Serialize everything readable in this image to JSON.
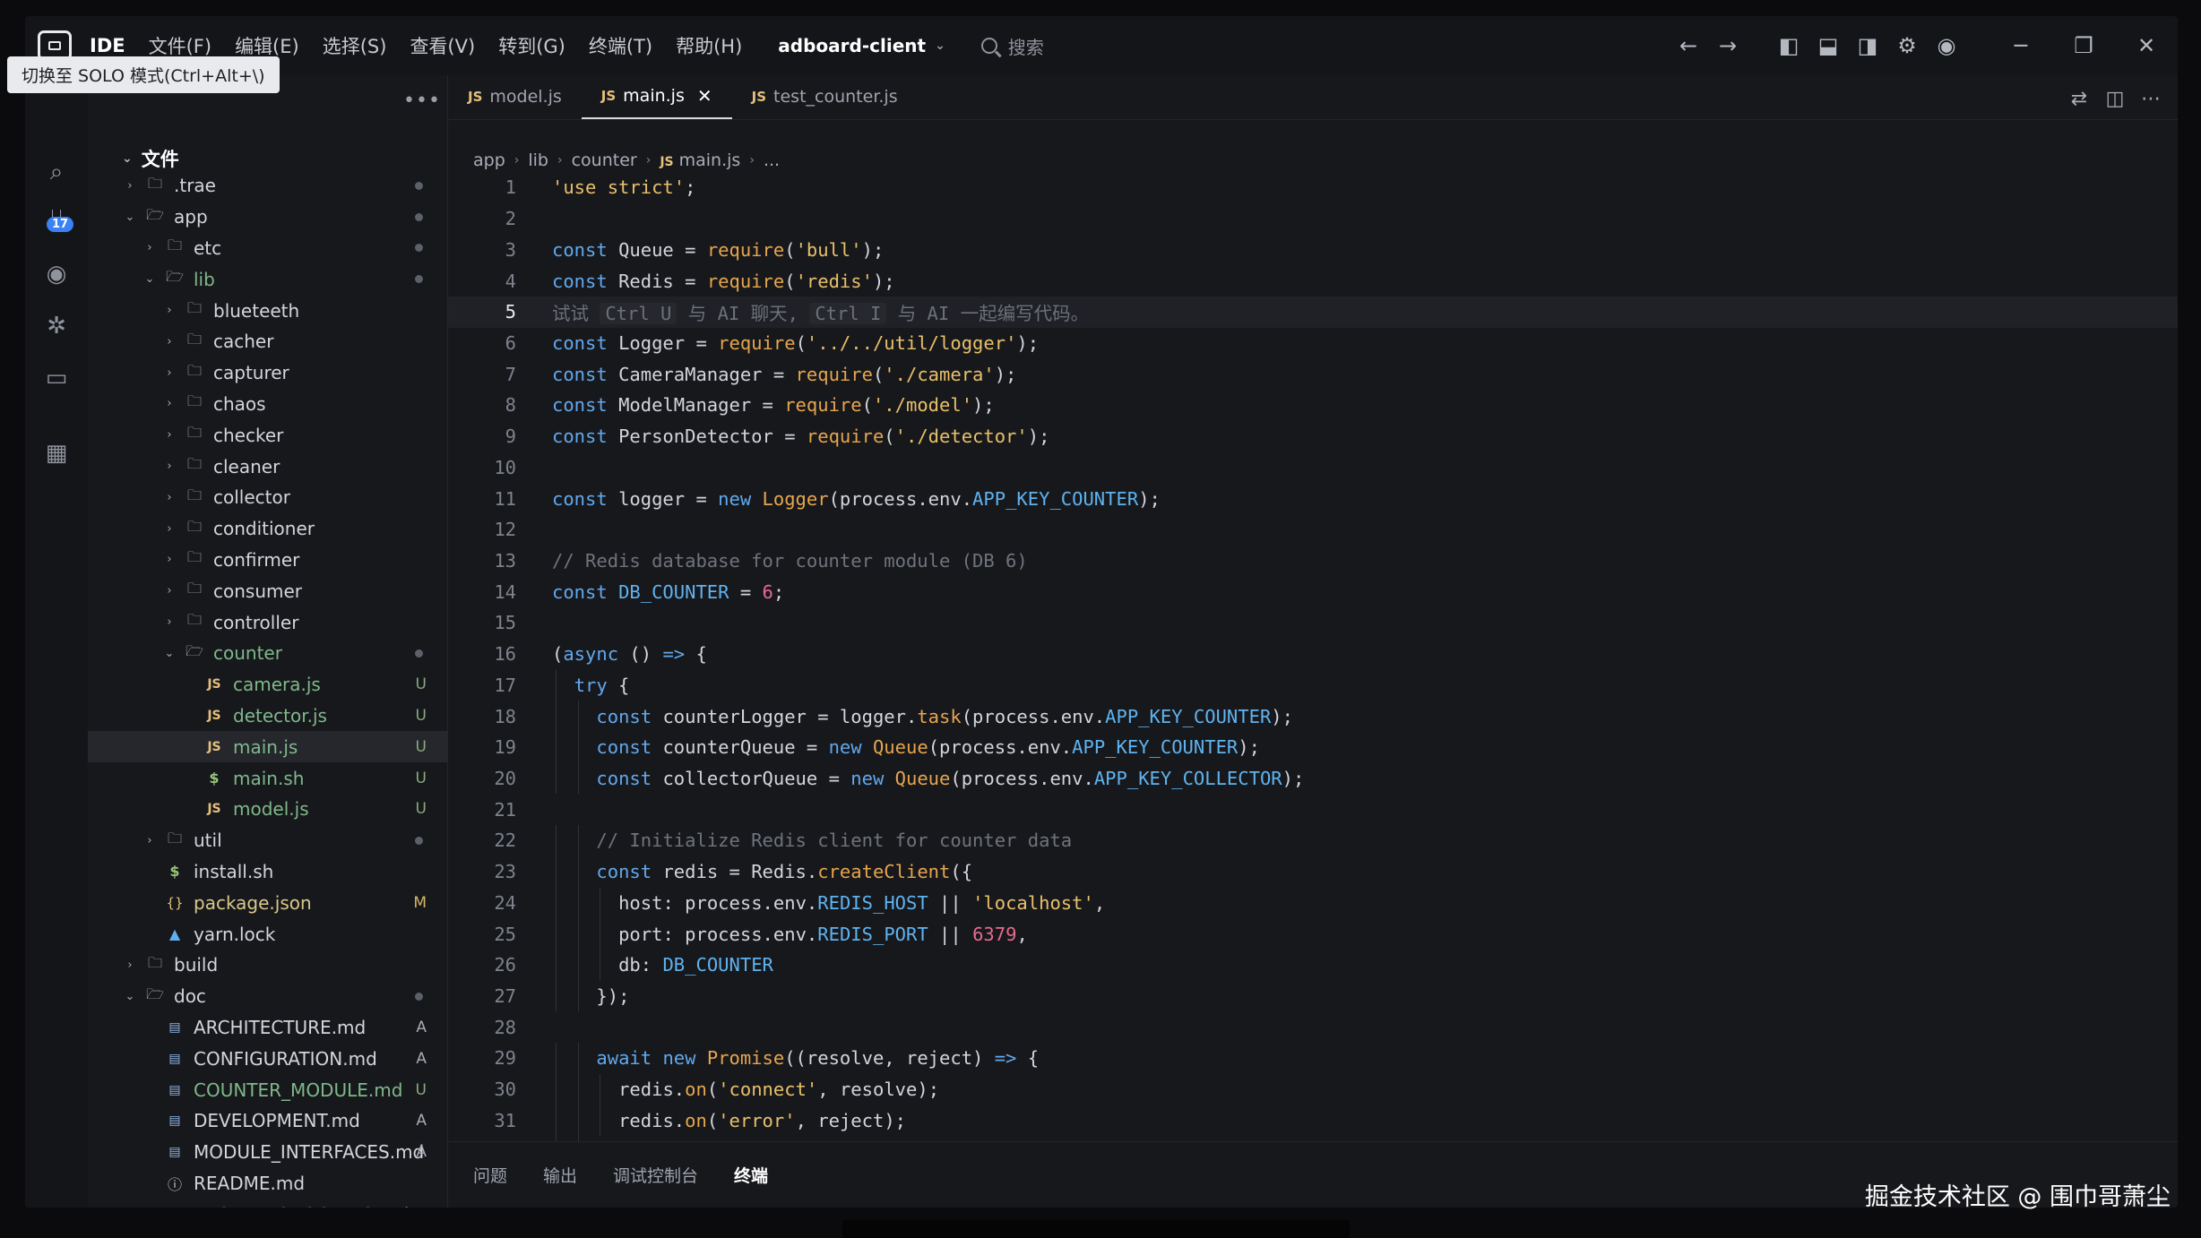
{
  "titlebar": {
    "menu": [
      "IDE",
      "文件(F)",
      "编辑(E)",
      "选择(S)",
      "查看(V)",
      "转到(G)",
      "终端(T)",
      "帮助(H)"
    ],
    "project": "adboard-client",
    "search_placeholder": "搜索"
  },
  "tooltip": "切换至 SOLO 模式(Ctrl+Alt+\\)",
  "activity": {
    "badge": "17"
  },
  "explorer": {
    "title": "文件",
    "items": [
      {
        "name": ".trae",
        "depth": 0,
        "type": "folder",
        "open": false,
        "status": "dot"
      },
      {
        "name": "app",
        "depth": 0,
        "type": "folder",
        "open": true,
        "status": "dot"
      },
      {
        "name": "etc",
        "depth": 1,
        "type": "folder",
        "open": false,
        "status": "dot"
      },
      {
        "name": "lib",
        "depth": 1,
        "type": "folder",
        "open": true,
        "status": "dot",
        "color": "green"
      },
      {
        "name": "blueteeth",
        "depth": 2,
        "type": "folder",
        "open": false,
        "status": ""
      },
      {
        "name": "cacher",
        "depth": 2,
        "type": "folder",
        "open": false,
        "status": ""
      },
      {
        "name": "capturer",
        "depth": 2,
        "type": "folder",
        "open": false,
        "status": ""
      },
      {
        "name": "chaos",
        "depth": 2,
        "type": "folder",
        "open": false,
        "status": ""
      },
      {
        "name": "checker",
        "depth": 2,
        "type": "folder",
        "open": false,
        "status": ""
      },
      {
        "name": "cleaner",
        "depth": 2,
        "type": "folder",
        "open": false,
        "status": ""
      },
      {
        "name": "collector",
        "depth": 2,
        "type": "folder",
        "open": false,
        "status": ""
      },
      {
        "name": "conditioner",
        "depth": 2,
        "type": "folder",
        "open": false,
        "status": ""
      },
      {
        "name": "confirmer",
        "depth": 2,
        "type": "folder",
        "open": false,
        "status": ""
      },
      {
        "name": "consumer",
        "depth": 2,
        "type": "folder",
        "open": false,
        "status": ""
      },
      {
        "name": "controller",
        "depth": 2,
        "type": "folder",
        "open": false,
        "status": ""
      },
      {
        "name": "counter",
        "depth": 2,
        "type": "folder",
        "open": true,
        "status": "dot",
        "color": "green"
      },
      {
        "name": "camera.js",
        "depth": 3,
        "type": "js",
        "status": "U",
        "color": "green"
      },
      {
        "name": "detector.js",
        "depth": 3,
        "type": "js",
        "status": "U",
        "color": "green"
      },
      {
        "name": "main.js",
        "depth": 3,
        "type": "js",
        "status": "U",
        "color": "green",
        "active": true
      },
      {
        "name": "main.sh",
        "depth": 3,
        "type": "sh",
        "status": "U",
        "color": "green"
      },
      {
        "name": "model.js",
        "depth": 3,
        "type": "js",
        "status": "U",
        "color": "green"
      },
      {
        "name": "util",
        "depth": 1,
        "type": "folder",
        "open": false,
        "status": "dot"
      },
      {
        "name": "install.sh",
        "depth": 1,
        "type": "sh",
        "status": ""
      },
      {
        "name": "package.json",
        "depth": 1,
        "type": "json",
        "status": "M",
        "color": "yellowish"
      },
      {
        "name": "yarn.lock",
        "depth": 1,
        "type": "yarn",
        "status": ""
      },
      {
        "name": "build",
        "depth": 0,
        "type": "folder",
        "open": false,
        "status": ""
      },
      {
        "name": "doc",
        "depth": 0,
        "type": "folder",
        "open": true,
        "status": "dot"
      },
      {
        "name": "ARCHITECTURE.md",
        "depth": 1,
        "type": "md",
        "status": "A"
      },
      {
        "name": "CONFIGURATION.md",
        "depth": 1,
        "type": "md",
        "status": "A"
      },
      {
        "name": "COUNTER_MODULE.md",
        "depth": 1,
        "type": "md",
        "status": "U",
        "color": "green"
      },
      {
        "name": "DEVELOPMENT.md",
        "depth": 1,
        "type": "md",
        "status": "A"
      },
      {
        "name": "MODULE_INTERFACES.md",
        "depth": 1,
        "type": "md",
        "status": "A"
      },
      {
        "name": "README.md",
        "depth": 1,
        "type": "info",
        "status": ""
      },
      {
        "name": "TROUBLESHOOTING.md",
        "depth": 1,
        "type": "md",
        "status": "A"
      }
    ]
  },
  "editor": {
    "tabs": [
      {
        "label": "model.js",
        "active": false
      },
      {
        "label": "main.js",
        "active": true
      },
      {
        "label": "test_counter.js",
        "active": false
      }
    ],
    "breadcrumb": [
      "app",
      "lib",
      "counter",
      "main.js",
      "..."
    ],
    "current_line": 5,
    "lines": [
      [
        [
          "str",
          "'use strict'"
        ],
        [
          "var",
          ";"
        ]
      ],
      [],
      [
        [
          "kw",
          "const "
        ],
        [
          "var",
          "Queue = "
        ],
        [
          "fn",
          "require"
        ],
        [
          "var",
          "("
        ],
        [
          "str",
          "'bull'"
        ],
        [
          "var",
          ");"
        ]
      ],
      [
        [
          "kw",
          "const "
        ],
        [
          "var",
          "Redis = "
        ],
        [
          "fn",
          "require"
        ],
        [
          "var",
          "("
        ],
        [
          "str",
          "'redis'"
        ],
        [
          "var",
          ");"
        ]
      ],
      [
        [
          "hint",
          "试试 "
        ],
        [
          "kbd",
          "Ctrl U"
        ],
        [
          "hint",
          " 与 AI 聊天, "
        ],
        [
          "kbd",
          "Ctrl I"
        ],
        [
          "hint",
          " 与 AI 一起编写代码。"
        ]
      ],
      [
        [
          "kw",
          "const "
        ],
        [
          "var",
          "Logger = "
        ],
        [
          "fn",
          "require"
        ],
        [
          "var",
          "("
        ],
        [
          "str",
          "'../../util/logger'"
        ],
        [
          "var",
          ");"
        ]
      ],
      [
        [
          "kw",
          "const "
        ],
        [
          "var",
          "CameraManager = "
        ],
        [
          "fn",
          "require"
        ],
        [
          "var",
          "("
        ],
        [
          "str",
          "'./camera'"
        ],
        [
          "var",
          ");"
        ]
      ],
      [
        [
          "kw",
          "const "
        ],
        [
          "var",
          "ModelManager = "
        ],
        [
          "fn",
          "require"
        ],
        [
          "var",
          "("
        ],
        [
          "str",
          "'./model'"
        ],
        [
          "var",
          ");"
        ]
      ],
      [
        [
          "kw",
          "const "
        ],
        [
          "var",
          "PersonDetector = "
        ],
        [
          "fn",
          "require"
        ],
        [
          "var",
          "("
        ],
        [
          "str",
          "'./detector'"
        ],
        [
          "var",
          ");"
        ]
      ],
      [],
      [
        [
          "kw",
          "const "
        ],
        [
          "var",
          "logger = "
        ],
        [
          "kw",
          "new "
        ],
        [
          "cls",
          "Logger"
        ],
        [
          "var",
          "(process.env."
        ],
        [
          "env",
          "APP_KEY_COUNTER"
        ],
        [
          "var",
          ");"
        ]
      ],
      [],
      [
        [
          "cm",
          "// Redis database for counter module (DB 6)"
        ]
      ],
      [
        [
          "kw",
          "const "
        ],
        [
          "env",
          "DB_COUNTER"
        ],
        [
          "var",
          " = "
        ],
        [
          "num",
          "6"
        ],
        [
          "var",
          ";"
        ]
      ],
      [],
      [
        [
          "var",
          "("
        ],
        [
          "kw",
          "async "
        ],
        [
          "var",
          "() "
        ],
        [
          "kw",
          "=>"
        ],
        [
          "var",
          " {"
        ]
      ],
      [
        [
          "ind",
          1
        ],
        [
          "kw",
          "try"
        ],
        [
          "var",
          " {"
        ]
      ],
      [
        [
          "ind",
          2
        ],
        [
          "kw",
          "const "
        ],
        [
          "var",
          "counterLogger = logger."
        ],
        [
          "fn",
          "task"
        ],
        [
          "var",
          "(process.env."
        ],
        [
          "env",
          "APP_KEY_COUNTER"
        ],
        [
          "var",
          ");"
        ]
      ],
      [
        [
          "ind",
          2
        ],
        [
          "kw",
          "const "
        ],
        [
          "var",
          "counterQueue = "
        ],
        [
          "kw",
          "new "
        ],
        [
          "cls",
          "Queue"
        ],
        [
          "var",
          "(process.env."
        ],
        [
          "env",
          "APP_KEY_COUNTER"
        ],
        [
          "var",
          ");"
        ]
      ],
      [
        [
          "ind",
          2
        ],
        [
          "kw",
          "const "
        ],
        [
          "var",
          "collectorQueue = "
        ],
        [
          "kw",
          "new "
        ],
        [
          "cls",
          "Queue"
        ],
        [
          "var",
          "(process.env."
        ],
        [
          "env",
          "APP_KEY_COLLECTOR"
        ],
        [
          "var",
          ");"
        ]
      ],
      [],
      [
        [
          "ind",
          2
        ],
        [
          "cm",
          "// Initialize Redis client for counter data"
        ]
      ],
      [
        [
          "ind",
          2
        ],
        [
          "kw",
          "const "
        ],
        [
          "var",
          "redis = Redis."
        ],
        [
          "fn",
          "createClient"
        ],
        [
          "var",
          "({"
        ]
      ],
      [
        [
          "ind",
          3
        ],
        [
          "var",
          "host: process.env."
        ],
        [
          "env",
          "REDIS_HOST"
        ],
        [
          "var",
          " || "
        ],
        [
          "str",
          "'localhost'"
        ],
        [
          "var",
          ","
        ]
      ],
      [
        [
          "ind",
          3
        ],
        [
          "var",
          "port: process.env."
        ],
        [
          "env",
          "REDIS_PORT"
        ],
        [
          "var",
          " || "
        ],
        [
          "num",
          "6379"
        ],
        [
          "var",
          ","
        ]
      ],
      [
        [
          "ind",
          3
        ],
        [
          "var",
          "db: "
        ],
        [
          "env",
          "DB_COUNTER"
        ]
      ],
      [
        [
          "ind",
          2
        ],
        [
          "var",
          "});"
        ]
      ],
      [],
      [
        [
          "ind",
          2
        ],
        [
          "kw",
          "await new "
        ],
        [
          "cls",
          "Promise"
        ],
        [
          "var",
          "((resolve, reject) "
        ],
        [
          "kw",
          "=>"
        ],
        [
          "var",
          " {"
        ]
      ],
      [
        [
          "ind",
          3
        ],
        [
          "var",
          "redis."
        ],
        [
          "fn",
          "on"
        ],
        [
          "var",
          "("
        ],
        [
          "str",
          "'connect'"
        ],
        [
          "var",
          ", resolve);"
        ]
      ],
      [
        [
          "ind",
          3
        ],
        [
          "var",
          "redis."
        ],
        [
          "fn",
          "on"
        ],
        [
          "var",
          "("
        ],
        [
          "str",
          "'error'"
        ],
        [
          "var",
          ", reject);"
        ]
      ],
      [
        [
          "ind",
          2
        ],
        [
          "var",
          "});"
        ]
      ]
    ]
  },
  "panel": {
    "tabs": [
      "问题",
      "输出",
      "调试控制台",
      "终端"
    ],
    "active": "终端"
  },
  "watermark": "掘金技术社区 @ 围巾哥萧尘",
  "colors": {
    "keyword": "#61a8ee",
    "string": "#e8c06a",
    "function": "#e6a54e",
    "number": "#e56b8c",
    "comment": "#6f737c",
    "untracked": "#7fb88a",
    "modified": "#d6b566"
  }
}
